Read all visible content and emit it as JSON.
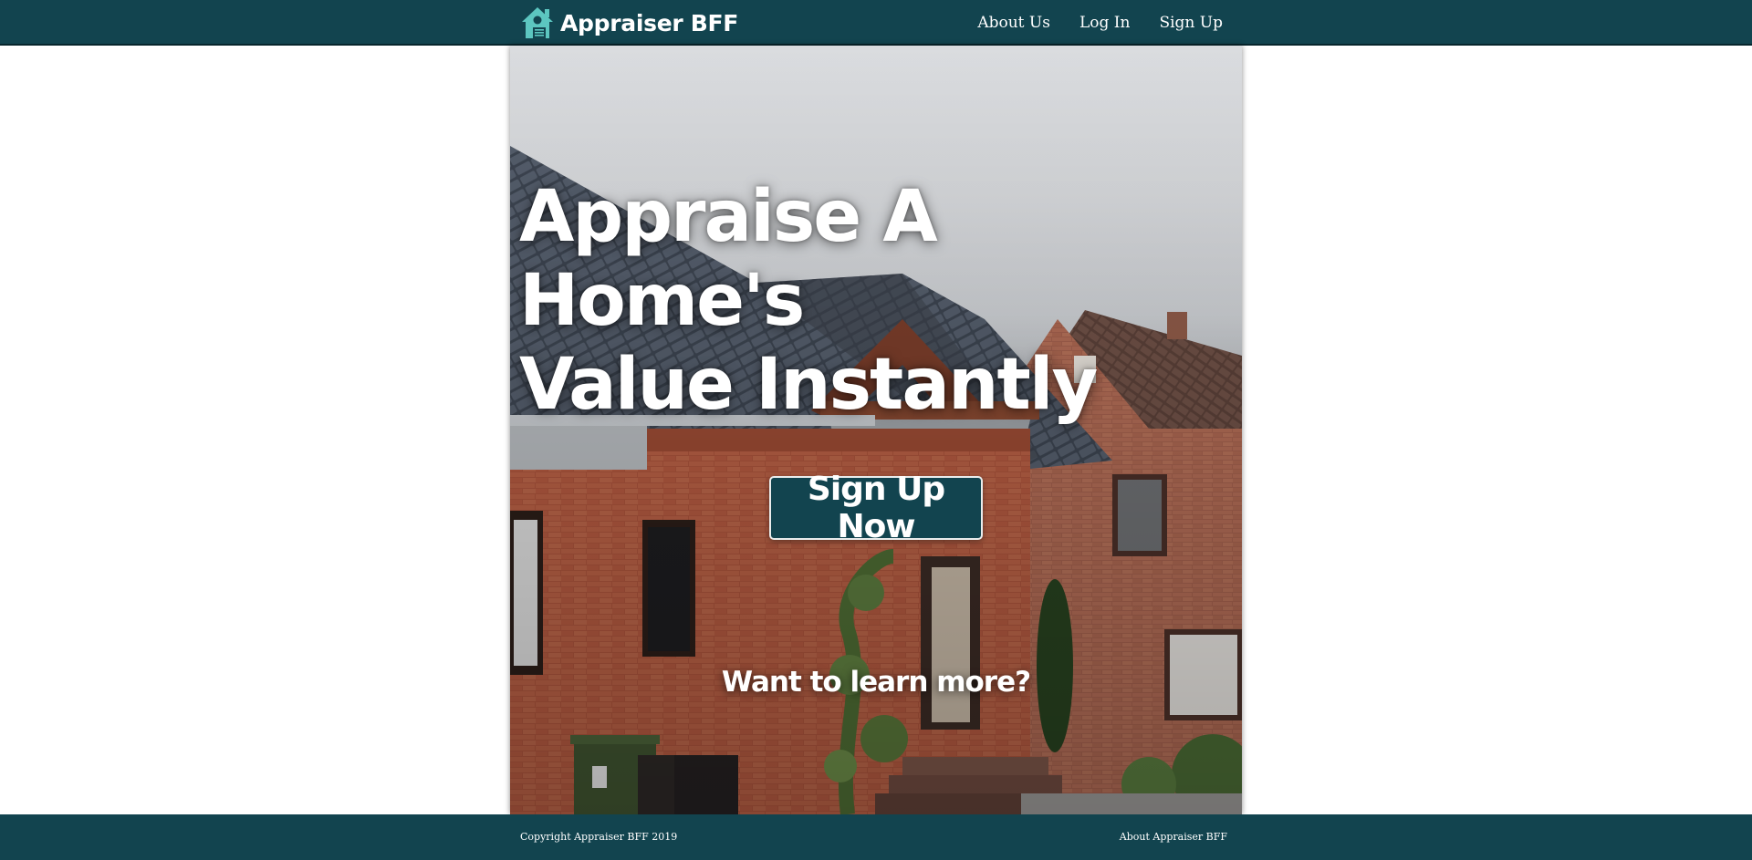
{
  "header": {
    "brand_name": "Appraiser BFF",
    "logo_icon": "house-icon",
    "nav": [
      {
        "label": "About Us"
      },
      {
        "label": "Log In"
      },
      {
        "label": "Sign Up"
      }
    ]
  },
  "hero": {
    "title_line1": "Appraise A Home's",
    "title_line2": "Value Instantly",
    "cta_label": "Sign Up Now",
    "learn_more": "Want to learn more?",
    "background": "brick-house-photo"
  },
  "footer": {
    "copyright": "Copyright Appraiser BFF 2019",
    "link": "About Appraiser BFF"
  },
  "colors": {
    "primary": "#12444f",
    "logo_accent": "#5cc6c0",
    "text_light": "#ffffff"
  }
}
